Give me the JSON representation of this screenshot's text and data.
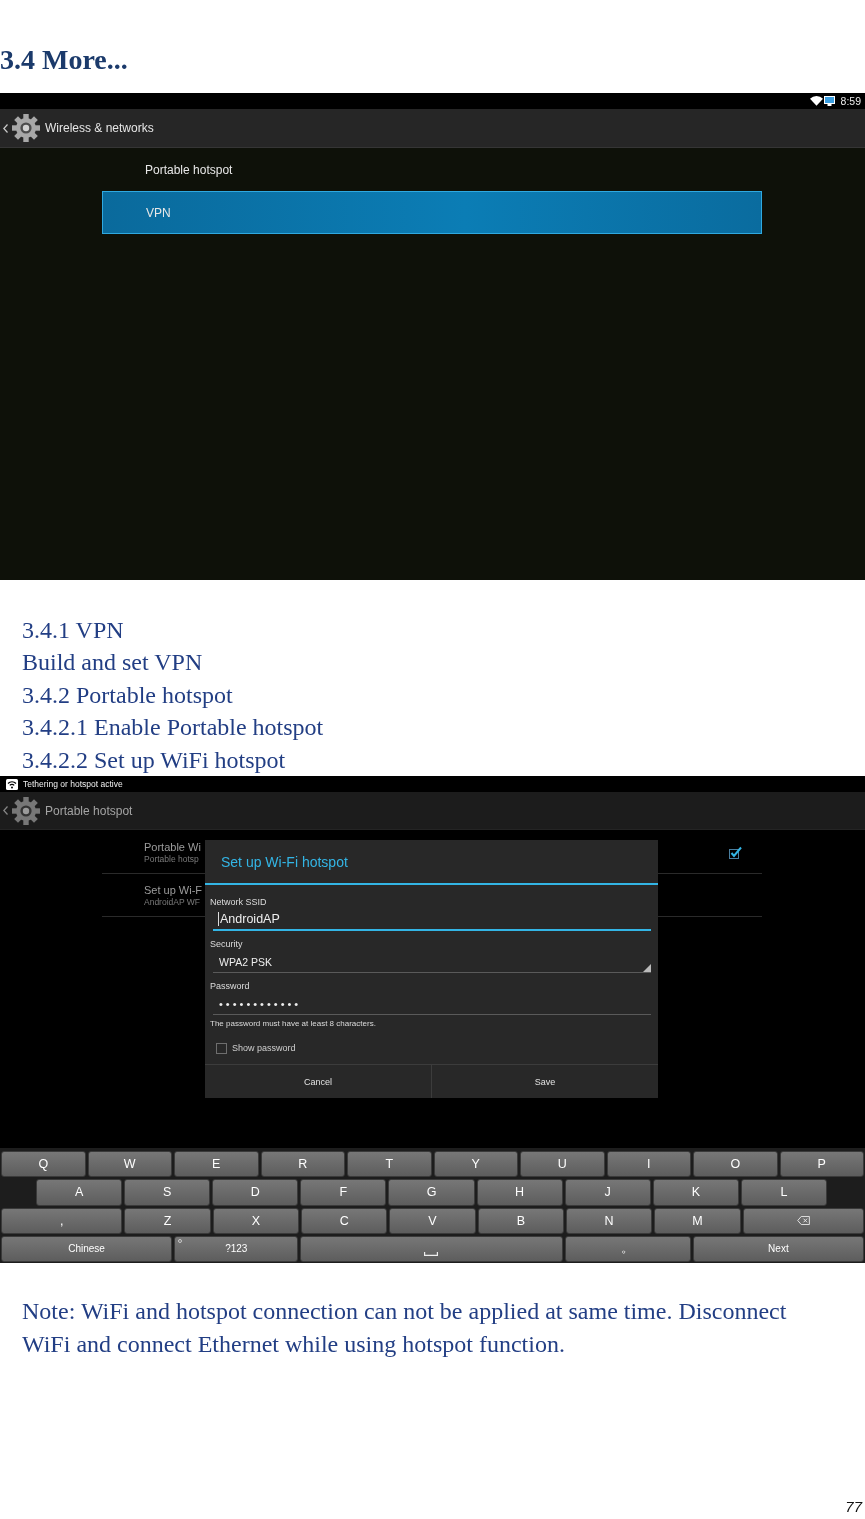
{
  "heading": "3.4 More...",
  "settings_screen": {
    "status_bar": {
      "time": "8:59"
    },
    "action_bar": {
      "title": "Wireless & networks"
    },
    "items": [
      {
        "label": "Portable hotspot",
        "selected": false
      },
      {
        "label": "VPN",
        "selected": true
      }
    ]
  },
  "sections": [
    "3.4.1 VPN",
    "Build and set VPN",
    "3.4.2 Portable hotspot",
    "3.4.2.1 Enable Portable hotspot",
    "3.4.2.2 Set up WiFi hotspot"
  ],
  "hotspot_screen": {
    "status_bar": {
      "notification": "Tethering or hotspot active"
    },
    "action_bar": {
      "title": "Portable hotspot"
    },
    "items": [
      {
        "kind": "checkbox",
        "title": "Portable Wi",
        "subtitle": "Portable hotsp",
        "checked": true
      },
      {
        "kind": "plain",
        "title": "Set up Wi-F",
        "subtitle": "AndroidAP WF"
      }
    ],
    "dialog": {
      "title": "Set up Wi-Fi hotspot",
      "fields": [
        {
          "kind": "text",
          "label": "Network SSID",
          "value": "AndroidAP",
          "focused": true
        },
        {
          "kind": "select",
          "label": "Security",
          "value": "WPA2 PSK",
          "focused": false
        },
        {
          "kind": "password",
          "label": "Password",
          "value": "••••••••••••",
          "focused": false
        }
      ],
      "hint": "The password must have at least 8 characters.",
      "show_password": {
        "label": "Show password",
        "checked": false
      },
      "buttons": [
        "Cancel",
        "Save"
      ]
    },
    "keyboard": {
      "rows": [
        [
          {
            "kind": "char",
            "label": "Q"
          },
          {
            "kind": "char",
            "label": "W"
          },
          {
            "kind": "char",
            "label": "E"
          },
          {
            "kind": "char",
            "label": "R"
          },
          {
            "kind": "char",
            "label": "T"
          },
          {
            "kind": "char",
            "label": "Y"
          },
          {
            "kind": "char",
            "label": "U"
          },
          {
            "kind": "char",
            "label": "I"
          },
          {
            "kind": "char",
            "label": "O"
          },
          {
            "kind": "char",
            "label": "P"
          }
        ],
        [
          {
            "kind": "char",
            "label": "A"
          },
          {
            "kind": "char",
            "label": "S"
          },
          {
            "kind": "char",
            "label": "D"
          },
          {
            "kind": "char",
            "label": "F"
          },
          {
            "kind": "char",
            "label": "G"
          },
          {
            "kind": "char",
            "label": "H"
          },
          {
            "kind": "char",
            "label": "J"
          },
          {
            "kind": "char",
            "label": "K"
          },
          {
            "kind": "char",
            "label": "L"
          }
        ],
        [
          {
            "kind": "char",
            "label": ","
          },
          {
            "kind": "char",
            "label": "Z"
          },
          {
            "kind": "char",
            "label": "X"
          },
          {
            "kind": "char",
            "label": "C"
          },
          {
            "kind": "char",
            "label": "V"
          },
          {
            "kind": "char",
            "label": "B"
          },
          {
            "kind": "char",
            "label": "N"
          },
          {
            "kind": "char",
            "label": "M"
          },
          {
            "kind": "delete"
          }
        ],
        [
          {
            "kind": "function",
            "label": "Chinese"
          },
          {
            "kind": "function",
            "label": "?123",
            "hint": true
          },
          {
            "kind": "space"
          },
          {
            "kind": "char",
            "label": "。"
          },
          {
            "kind": "function",
            "label": "Next"
          }
        ]
      ]
    }
  },
  "note": "Note: WiFi and hotspot connection can not be applied at same time. Disconnect WiFi and connect Ethernet while using hotspot function.",
  "page_number": "77"
}
